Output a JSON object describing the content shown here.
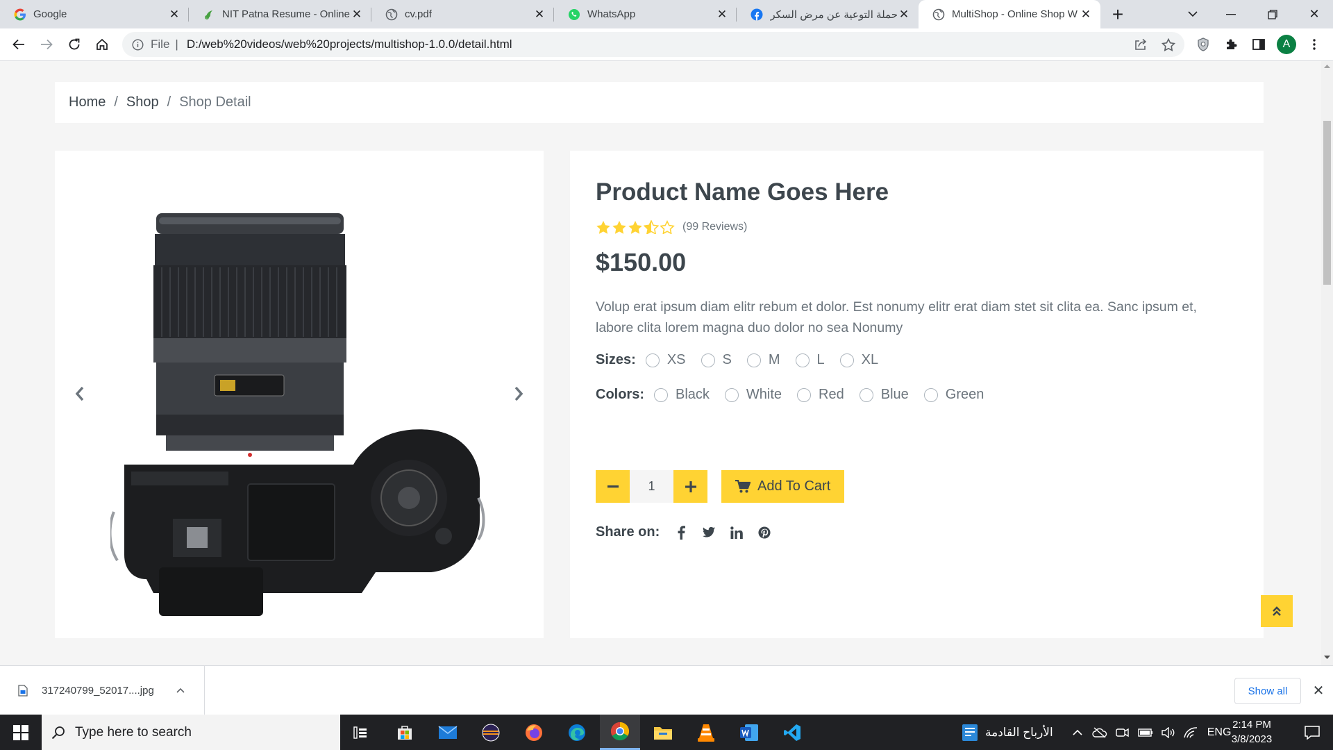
{
  "browser": {
    "tabs": [
      {
        "title": "Google",
        "icon": "google-g-icon"
      },
      {
        "title": "NIT Patna Resume - Online",
        "icon": "overleaf-icon"
      },
      {
        "title": "cv.pdf",
        "icon": "globe-icon"
      },
      {
        "title": "WhatsApp",
        "icon": "whatsapp-icon"
      },
      {
        "title": "حملة التوعية عن مرض السكري",
        "icon": "facebook-icon"
      },
      {
        "title": "MultiShop - Online Shop W",
        "icon": "globe-icon",
        "active": true
      }
    ],
    "address": {
      "scheme_label": "File",
      "url": "D:/web%20videos/web%20projects/multishop-1.0.0/detail.html"
    },
    "profile_initial": "A"
  },
  "page": {
    "breadcrumb": [
      "Home",
      "Shop",
      "Shop Detail"
    ],
    "product": {
      "name": "Product Name Goes Here",
      "rating": 3.5,
      "rating_max": 5,
      "reviews": "(99 Reviews)",
      "price": "$150.00",
      "description": "Volup erat ipsum diam elitr rebum et dolor. Est nonumy elitr erat diam stet sit clita ea. Sanc ipsum et, labore clita lorem magna duo dolor no sea Nonumy",
      "sizes_label": "Sizes:",
      "sizes": [
        "XS",
        "S",
        "M",
        "L",
        "XL"
      ],
      "colors_label": "Colors:",
      "colors": [
        "Black",
        "White",
        "Red",
        "Blue",
        "Green"
      ],
      "quantity": "1",
      "add_to_cart": "Add To Cart",
      "share_label": "Share on:",
      "share_icons": [
        "facebook-icon",
        "twitter-icon",
        "linkedin-icon",
        "pinterest-icon"
      ]
    },
    "accent_color": "#FFD333"
  },
  "downloads": {
    "file": "317240799_52017....jpg",
    "show_all": "Show all"
  },
  "taskbar": {
    "search_placeholder": "Type here to search",
    "weather_text": "الأرباح القادمة",
    "language": "ENG",
    "time": "2:14 PM",
    "date": "3/8/2023"
  }
}
